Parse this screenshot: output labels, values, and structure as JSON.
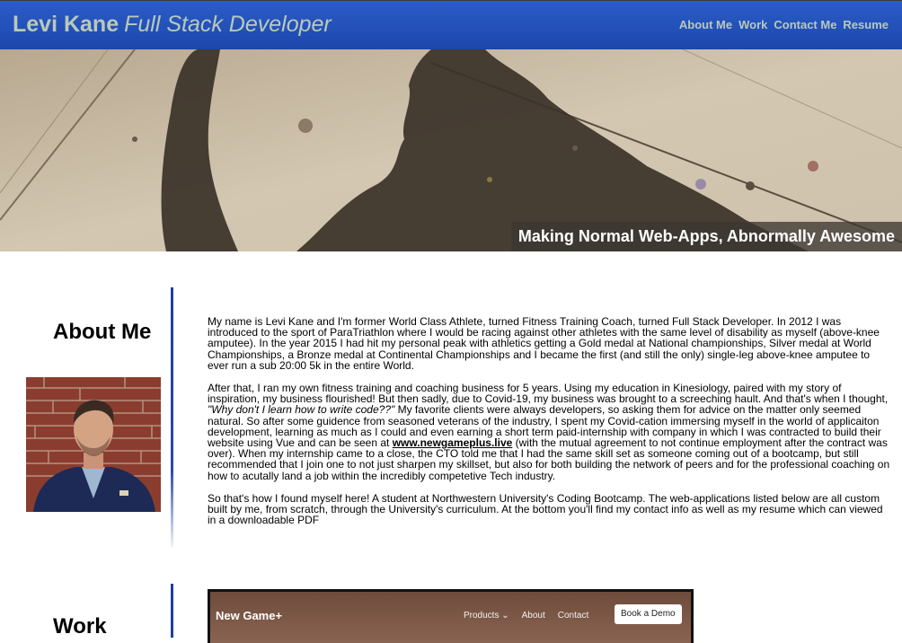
{
  "header": {
    "name": "Levi Kane",
    "role": "Full Stack Developer",
    "nav": [
      "About Me",
      "Work",
      "Contact Me",
      "Resume"
    ]
  },
  "hero": {
    "tagline": "Making Normal Web-Apps, Abnormally Awesome"
  },
  "about": {
    "title": "About Me",
    "p1": "My name is Levi Kane and I'm former World Class Athlete, turned Fitness Training Coach, turned Full Stack Developer. In 2012 I was introduced to the sport of ParaTriathlon where I would be racing against other athletes with the same level of disability as myself (above-knee amputee). In the year 2015 I had hit my personal peak with athletics getting a Gold medal at National championships, Silver medal at World Championships, a Bronze medal at Continental Championships and I became the first (and still the only) single-leg above-knee amputee to ever run a sub 20:00 5k in the entire World.",
    "p2_a": "After that, I ran my own fitness training and coaching business for 5 years. Using my education in Kinesiology, paired with my story of inspiration, my business flourished! But then sadly, due to Covid-19, my business was brought to a screeching hault. And that's when I thought,",
    "p2_quote": "\"Why don't I learn how to write code??\"",
    "p2_b": " My favorite clients were always developers, so asking them for advice on the matter only seemed natural. So after some guidence from seasoned veterans of the industry, I spent my Covid-cation immersing myself in the world of applicaiton development, learning as much as I could and even earning a short term paid-internship with company in which I was contracted to build their website using Vue and can be seen at ",
    "p2_link": "www.newgameplus.live",
    "p2_c": " (with the mutual agreement to not continue employment after the contract was over). When my internship came to a close, the CTO told me that I had the same skill set as someone coming out of a bootcamp, but still recommended that I join one to not just sharpen my skillset, but also for both building the network of peers and for the professional coaching on how to acutally land a job within the incredibly competetive Tech industry.",
    "p3": "So that's how I found myself here! A student at Northwestern University's Coding Bootcamp. The web-applications listed below are all custom built by me, from scratch, through the University's curriculum. At the bottom you'll find my contact info as well as my resume which can viewed in a downloadable PDF"
  },
  "work": {
    "title": "Work",
    "project": {
      "brand": "New Game+",
      "nav": [
        "Products ⌄",
        "About",
        "Contact"
      ],
      "cta": "Book a Demo"
    }
  },
  "colors": {
    "header_bg": "#2250b8",
    "header_text": "#b9c9bb",
    "divider": "#1f3f9a",
    "tagline_bg": "#3c3732"
  }
}
